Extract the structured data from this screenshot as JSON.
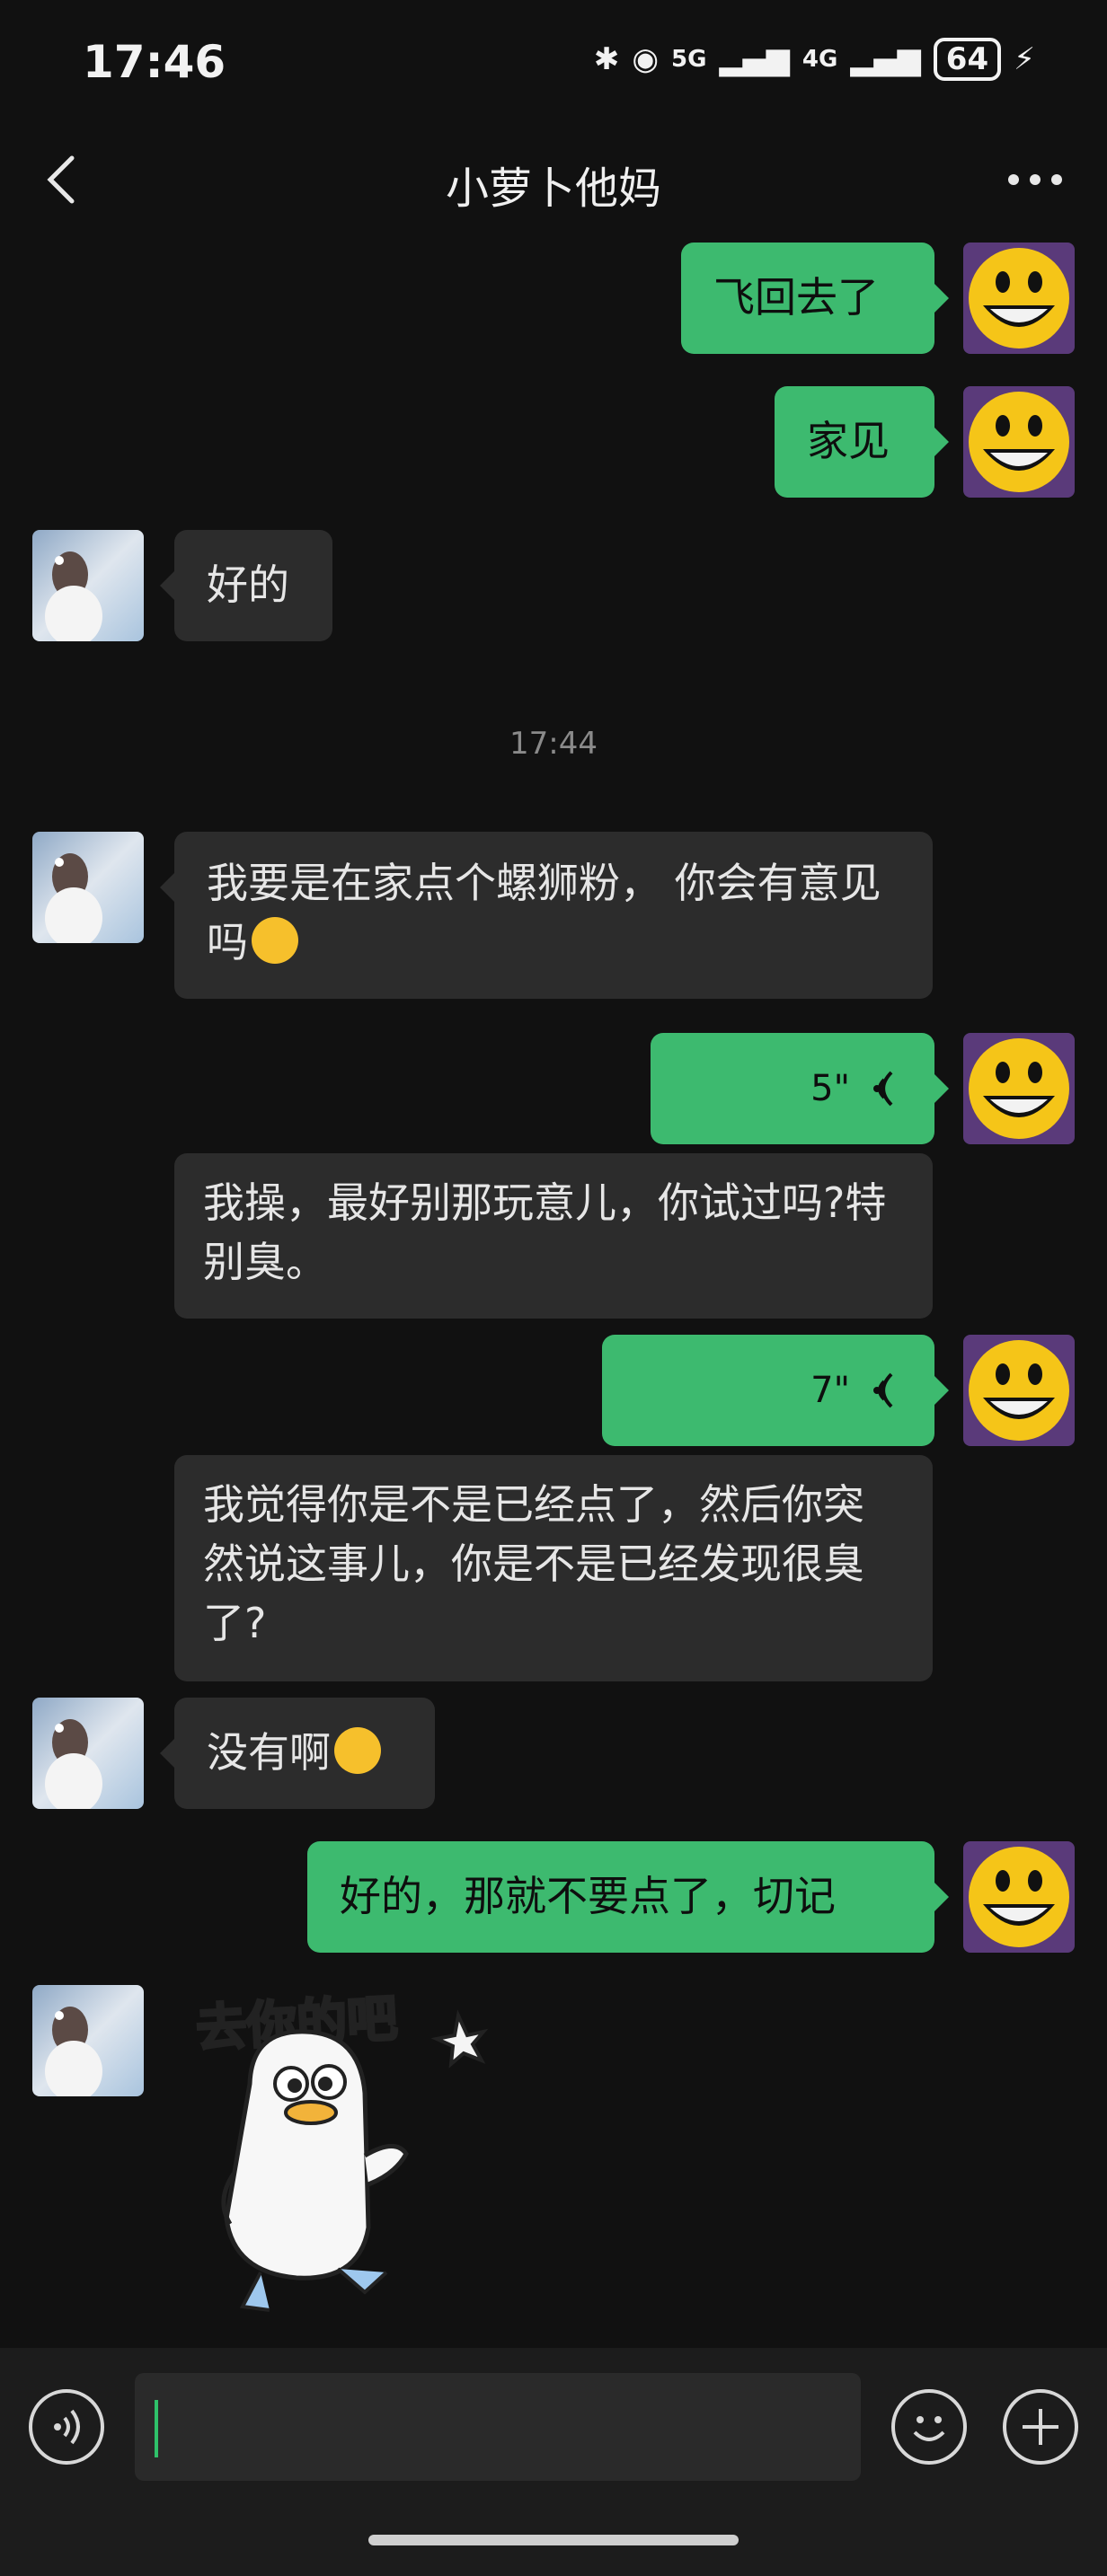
{
  "status_bar": {
    "time": "17:46",
    "net1": "5G",
    "net2": "4G",
    "battery": "64"
  },
  "header": {
    "title": "小萝卜他妈"
  },
  "messages": {
    "m1": "飞回去了",
    "m2": "家见",
    "m3": "好的",
    "timestamp": "17:44",
    "m4": "我要是在家点个螺狮粉， 你会有意见吗",
    "m5_duration": "5\"",
    "m6": "我操，最好别那玩意儿，你试过吗?特别臭。",
    "m7_duration": "7\"",
    "m8": "我觉得你是不是已经点了，然后你突然说这事儿，你是不是已经发现很臭了?",
    "m9": "没有啊",
    "m10": "好的，那就不要点了，切记",
    "sticker_text": "去你的吧"
  },
  "input": {
    "value": ""
  },
  "colors": {
    "accent_green": "#3dba6f",
    "bubble_gray": "#2c2c2c",
    "background": "#111111"
  }
}
